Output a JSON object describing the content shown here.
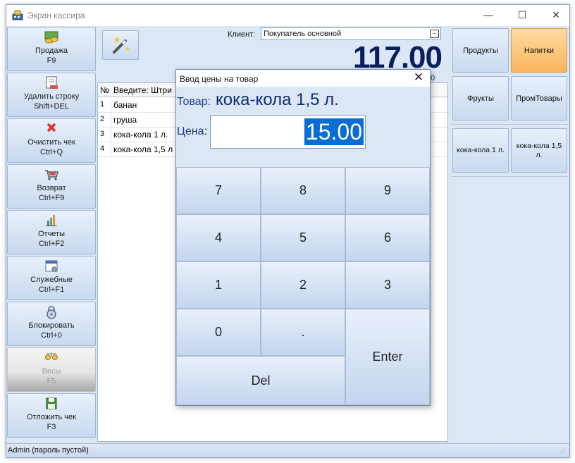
{
  "window": {
    "title": "Экран кассира",
    "minimize_glyph": "—",
    "maximize_glyph": "☐",
    "close_glyph": "✕"
  },
  "sidebar": {
    "items": [
      {
        "label": "Продажа",
        "shortcut": "F9",
        "icon": "coins-icon"
      },
      {
        "label": "Удалить строку",
        "shortcut": "Shift+DEL",
        "icon": "delete-row-icon"
      },
      {
        "label": "Очистить чек",
        "shortcut": "Ctrl+Q",
        "icon": "red-x-icon"
      },
      {
        "label": "Возврат",
        "shortcut": "Ctrl+F9",
        "icon": "return-cart-icon"
      },
      {
        "label": "Отчеты",
        "shortcut": "Ctrl+F2",
        "icon": "bar-chart-icon"
      },
      {
        "label": "Служебные",
        "shortcut": "Ctrl+F1",
        "icon": "settings-window-icon"
      },
      {
        "label": "Блокировать",
        "shortcut": "Ctrl+0",
        "icon": "padlock-icon"
      },
      {
        "label": "Весы",
        "shortcut": "F5",
        "icon": "scales-icon",
        "disabled": true
      },
      {
        "label": "Отложить чек",
        "shortcut": "F3",
        "icon": "floppy-disk-icon"
      }
    ]
  },
  "toolbar": {
    "wand_icon": "magic-wand-icon"
  },
  "client": {
    "label": "Клиент:",
    "value": "Покупатель основной",
    "browse_glyph": "..."
  },
  "total": {
    "amount": "117.00",
    "sub": "00"
  },
  "receipt": {
    "columns": {
      "number": "№",
      "name": "Введите: Штри"
    },
    "rows": [
      {
        "n": "1",
        "name": "банан"
      },
      {
        "n": "2",
        "name": "груша"
      },
      {
        "n": "3",
        "name": "кока-кола 1 л."
      },
      {
        "n": "4",
        "name": "кока-кола 1,5 л"
      }
    ]
  },
  "categories": [
    {
      "label": "Продукты",
      "active": false
    },
    {
      "label": "Напитки",
      "active": true
    },
    {
      "label": "Фрукты",
      "active": false
    },
    {
      "label": "ПромТовары",
      "active": false
    }
  ],
  "products": [
    {
      "label": "кока-кола 1 л."
    },
    {
      "label": "кока-кола 1,5 л."
    }
  ],
  "status": {
    "user": "Admin (пароль пустой)"
  },
  "dialog": {
    "title": "Ввод цены на товар",
    "close_glyph": "✕",
    "product_label": "Товар:",
    "product_name": "кока-кола 1,5 л.",
    "price_label": "Цена:",
    "price_value": "15.00",
    "keys": {
      "k7": "7",
      "k8": "8",
      "k9": "9",
      "k4": "4",
      "k5": "5",
      "k6": "6",
      "k1": "1",
      "k2": "2",
      "k3": "3",
      "k0": "0",
      "dot": ".",
      "enter": "Enter",
      "del": "Del"
    }
  },
  "colors": {
    "accent": "#0a1f5c",
    "active_category": "#f8b45c",
    "selection": "#0a6cd6"
  }
}
